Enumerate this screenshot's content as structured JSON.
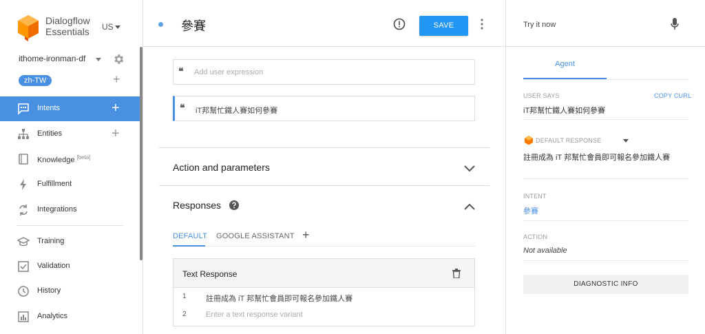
{
  "brand": {
    "line1": "Dialogflow",
    "line2": "Essentials",
    "region": "US"
  },
  "agent": {
    "name": "ithome-ironman-df",
    "language": "zh-TW"
  },
  "nav": {
    "intents": "Intents",
    "entities": "Entities",
    "knowledge": "Knowledge",
    "knowledge_badge": "[beta]",
    "fulfillment": "Fulfillment",
    "integrations": "Integrations",
    "training": "Training",
    "validation": "Validation",
    "history": "History",
    "analytics": "Analytics"
  },
  "intent": {
    "title": "參賽",
    "save_label": "SAVE",
    "add_expression_placeholder": "Add user expression",
    "expressions": [
      "iT邦幫忙鐵人賽如何參賽"
    ],
    "action_section": "Action and parameters",
    "responses_section": "Responses",
    "tabs": {
      "default": "DEFAULT",
      "google": "GOOGLE ASSISTANT"
    },
    "text_response": {
      "title": "Text Response",
      "rows": [
        {
          "num": "1",
          "text": "註冊成為 iT 邦幫忙會員即可報名參加鐵人賽"
        },
        {
          "num": "2",
          "placeholder": "Enter a text response variant"
        }
      ]
    }
  },
  "console": {
    "try_it_now": "Try it now",
    "tab_agent": "Agent",
    "user_says_label": "USER SAYS",
    "copy_curl": "COPY CURL",
    "user_says_value": "iT邦幫忙鐵人賽如何參賽",
    "default_response_label": "DEFAULT RESPONSE",
    "default_response_value": "註冊成為 iT 邦幫忙會員即可報名參加鐵人賽",
    "intent_label": "INTENT",
    "intent_value": "參賽",
    "action_label": "ACTION",
    "action_value": "Not available",
    "diagnostic_info": "DIAGNOSTIC INFO"
  },
  "colors": {
    "accent": "#4a90e2",
    "save": "#2196f3",
    "logo": "#f57c00"
  }
}
